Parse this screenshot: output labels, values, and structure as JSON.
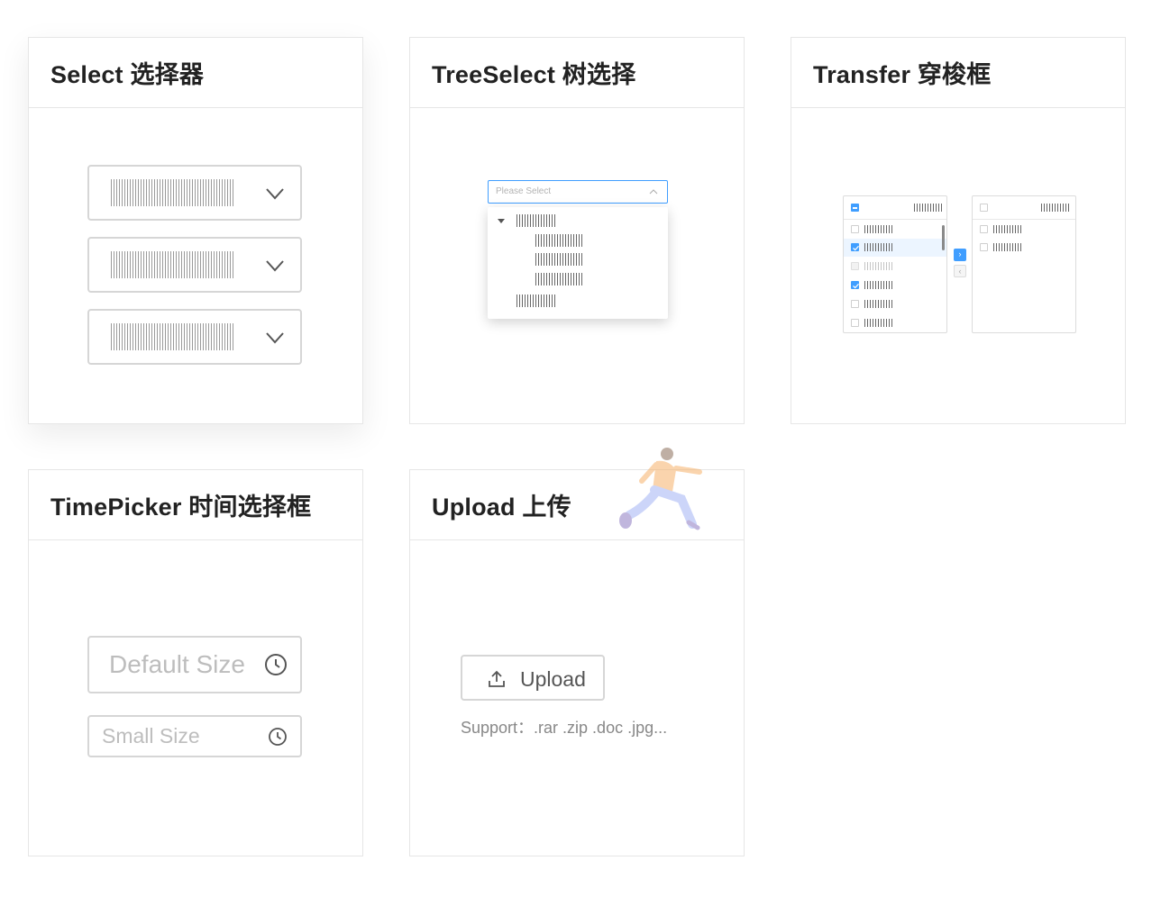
{
  "cards": {
    "select": {
      "title": "Select 选择器"
    },
    "treeselect": {
      "title": "TreeSelect 树选择",
      "placeholder": "Please Select"
    },
    "transfer": {
      "title": "Transfer 穿梭框"
    },
    "timepicker": {
      "title": "TimePicker 时间选择框",
      "default_placeholder": "Default Size",
      "small_placeholder": "Small Size"
    },
    "upload": {
      "title": "Upload 上传",
      "button_label": "Upload",
      "tip": "Support：.rar .zip .doc .jpg..."
    }
  },
  "colors": {
    "accent": "#409eff",
    "border": "#e6e6e6",
    "placeholder": "#bdbdbd"
  },
  "icons": [
    "chevron-down-icon",
    "chevron-up-icon",
    "caret-down-icon",
    "check-icon",
    "arrow-right-icon",
    "arrow-left-icon",
    "clock-icon",
    "upload-icon"
  ]
}
